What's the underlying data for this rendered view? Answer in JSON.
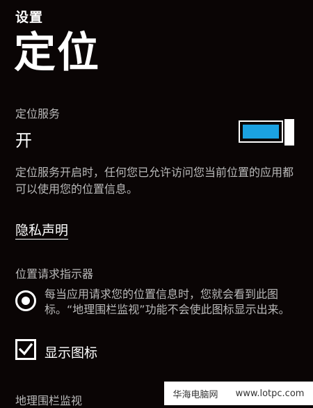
{
  "header": {
    "app_title": "设置",
    "page_title": "定位"
  },
  "location_service": {
    "label": "定位服务",
    "state": "开",
    "toggle_on": true
  },
  "description": "定位服务开启时，任何您已允许访问您当前位置的应用都可以使用您的位置信息。",
  "privacy_link": "隐私声明",
  "indicator": {
    "label": "位置请求指示器",
    "radio_text": "每当应用请求您的位置信息时，您就会看到此图标。“地理围栏监视”功能不会使此图标显示出来。",
    "checkbox_label": "显示图标",
    "checked": true
  },
  "geofence_label": "地理围栏监视",
  "watermark": {
    "left": "华海电脑网",
    "right": "www.lotpc.com"
  },
  "colors": {
    "accent": "#1ba1e2",
    "background": "#0a0505",
    "secondary_text": "#b9b9b9"
  }
}
